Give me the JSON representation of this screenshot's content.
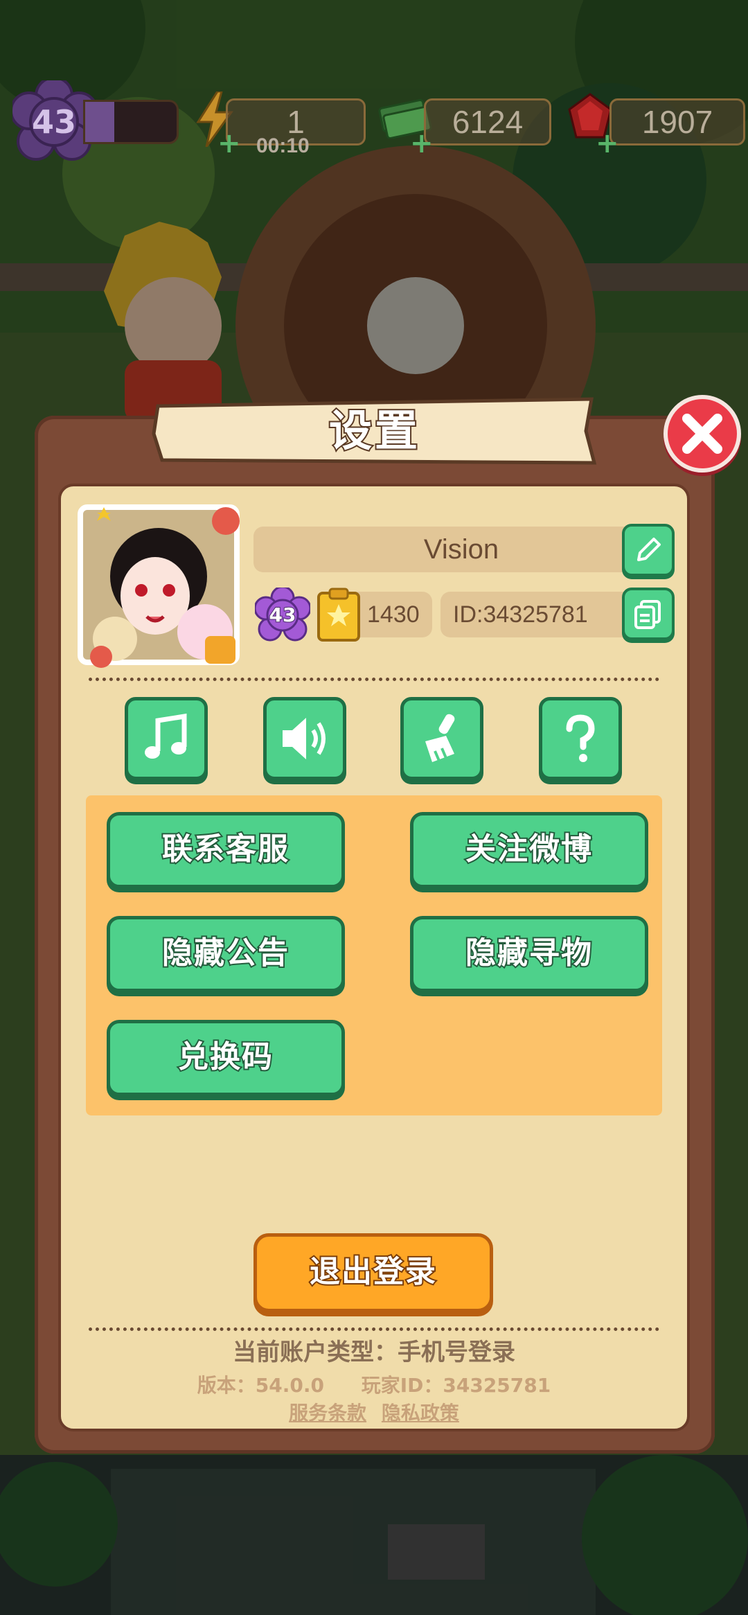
{
  "hud": {
    "level": "43",
    "xp_fraction": 0.32,
    "energy": "1",
    "energy_timer": "00:10",
    "cash": "6124",
    "gems": "1907"
  },
  "dialog": {
    "title": "设置",
    "profile": {
      "name": "Vision",
      "level": "43",
      "stars": "1430",
      "id": "ID:34325781"
    },
    "icon_buttons": [
      "music-icon",
      "sound-icon",
      "brush-icon",
      "help-icon"
    ],
    "menu_buttons": {
      "customer_service": "联系客服",
      "follow_weibo": "关注微博",
      "hide_notice": "隐藏公告",
      "hide_search": "隐藏寻物",
      "redeem_code": "兑换码"
    },
    "logout": "退出登录",
    "account_type": "当前账户类型：手机号登录",
    "version": "版本：54.0.0",
    "player_id": "玩家ID：34325781",
    "terms": "服务条款",
    "privacy": "隐私政策"
  },
  "colors": {
    "button_green": "#4ed18b",
    "panel_orange": "#fcc26a",
    "logout_orange": "#ffa726",
    "close_red": "#ea3b48",
    "dialog_brown": "#7c4a36",
    "dialog_cream": "#f0dcaa"
  }
}
